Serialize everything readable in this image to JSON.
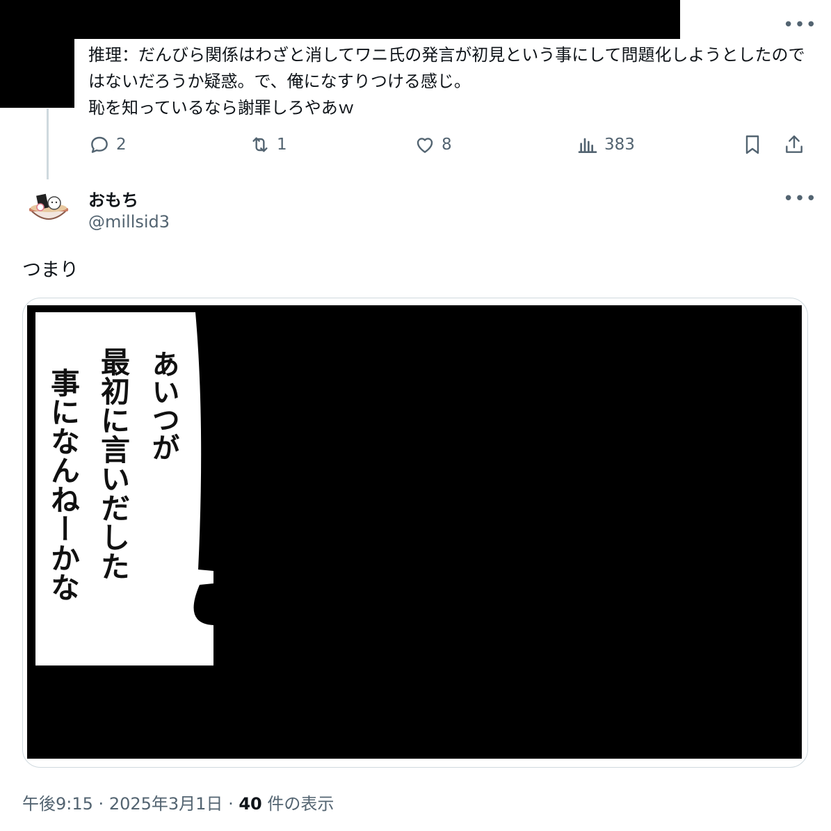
{
  "top_tweet": {
    "text": "推理：だんびら関係はわざと消してワニ氏の発言が初見という事にして問題化しようとしたのではないだろうか疑惑。で、俺になすりつける感じ。\n恥を知っているなら謝罪しろやあｗ",
    "replies": "2",
    "reposts": "1",
    "likes": "8",
    "views": "383"
  },
  "main_tweet": {
    "display_name": "おもち",
    "handle": "@millsid3",
    "text": "つまり",
    "time": "午後9:15",
    "date": "2025年3月1日",
    "view_count": "40",
    "view_label": "件の表示"
  },
  "media": {
    "col1": "事になんねーかな",
    "col2": "最初に言いだした",
    "col3": "あいつが"
  },
  "more_label": "•••",
  "colors": {
    "secondary": "#536471",
    "border": "#cfd9de",
    "text": "#0f1419"
  }
}
